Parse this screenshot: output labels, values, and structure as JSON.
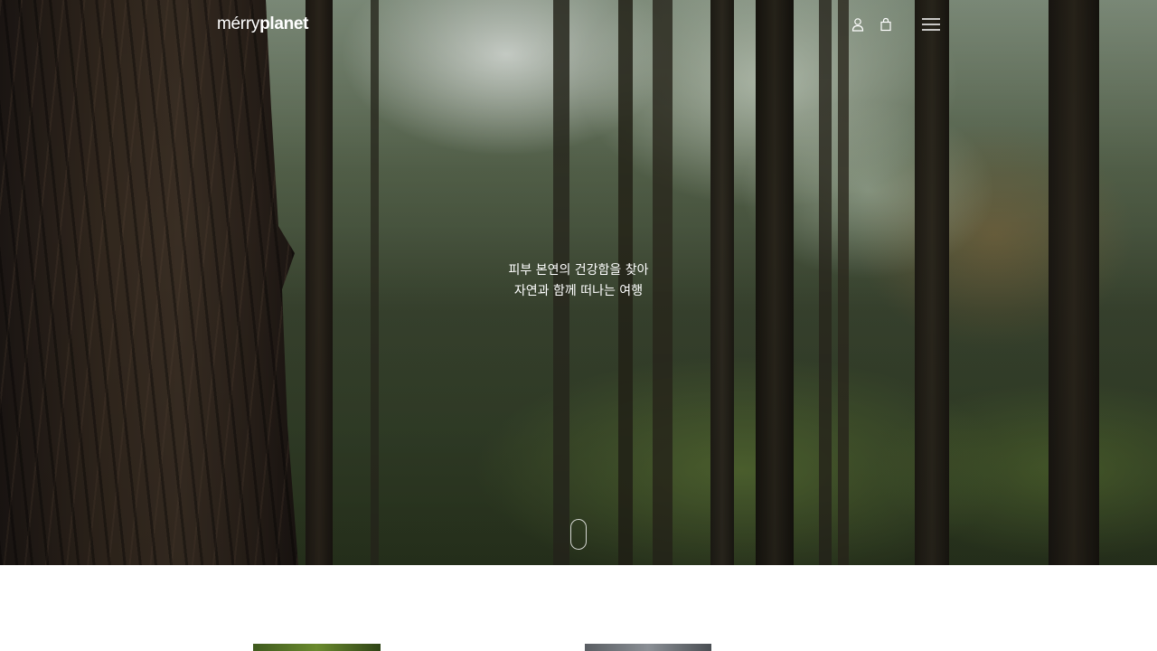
{
  "header": {
    "logo": {
      "part1": "mérry",
      "part2": "planet"
    },
    "icons": {
      "account": "user-icon",
      "cart": "shopping-bag-icon",
      "menu": "hamburger-menu-icon"
    }
  },
  "hero": {
    "tagline_line1": "피부 본연의 건강함을 찾아",
    "tagline_line2": "자연과 함께 떠나는 여행",
    "scroll_icon": "scroll-down-icon"
  },
  "colors": {
    "text_on_hero": "#ffffff",
    "page_background": "#ffffff"
  }
}
